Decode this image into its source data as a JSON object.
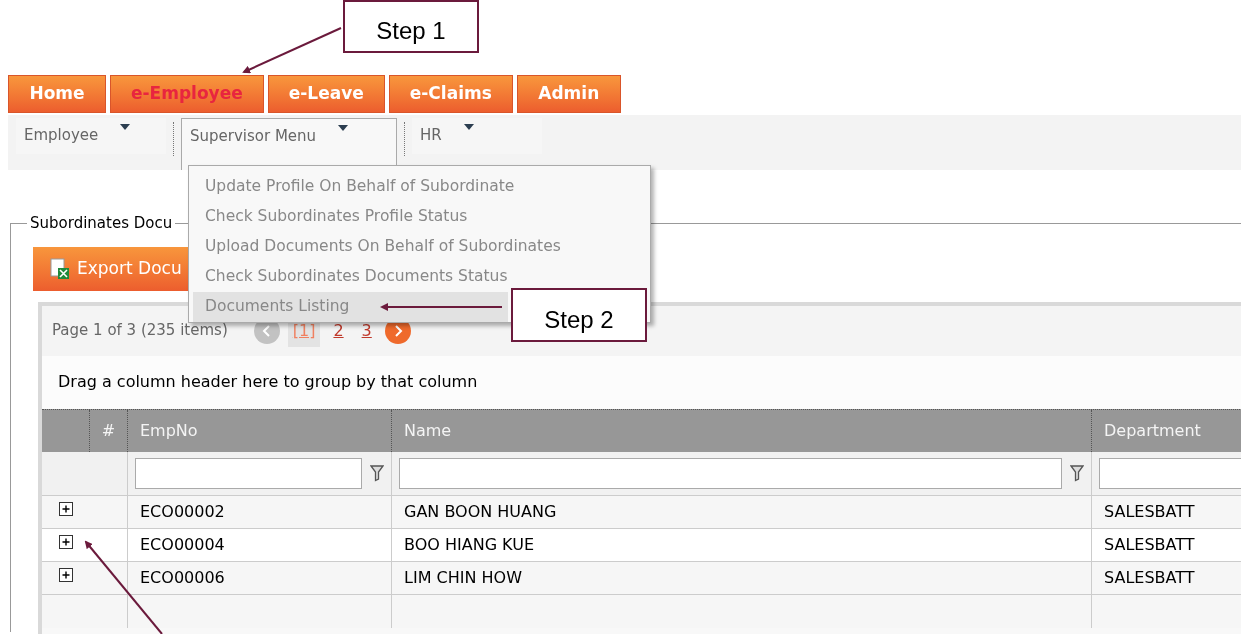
{
  "callouts": [
    {
      "text": "Step 1"
    },
    {
      "text": "Step 2"
    }
  ],
  "nav_tabs": [
    {
      "label": "Home",
      "selected": false
    },
    {
      "label": "e-Employee",
      "selected": true
    },
    {
      "label": "e-Leave",
      "selected": false
    },
    {
      "label": "e-Claims",
      "selected": false
    },
    {
      "label": "Admin",
      "selected": false
    }
  ],
  "sub_menu": [
    {
      "label": "Employee",
      "selected": false
    },
    {
      "label": "Supervisor Menu",
      "selected": true
    },
    {
      "label": "HR",
      "selected": false
    }
  ],
  "dropdown_items": [
    {
      "label": "Update Profile On Behalf of Subordinate",
      "selected": false
    },
    {
      "label": "Check Subordinates Profile Status",
      "selected": false
    },
    {
      "label": "Upload Documents On Behalf of Subordinates",
      "selected": false
    },
    {
      "label": "Check Subordinates Documents Status",
      "selected": false
    },
    {
      "label": "Documents Listing",
      "selected": true
    }
  ],
  "section": {
    "legend": "Subordinates Docu",
    "export_button": "Export Docu"
  },
  "pager": {
    "summary": "Page 1 of 3 (235 items)",
    "prev_enabled": false,
    "next_enabled": true,
    "pages": [
      {
        "label": "[1]",
        "selected": true
      },
      {
        "label": "2",
        "selected": false
      },
      {
        "label": "3",
        "selected": false
      }
    ]
  },
  "group_hint": "Drag a column header here to group by that column",
  "table": {
    "columns": [
      "#",
      "EmpNo",
      "Name",
      "Department"
    ],
    "rows": [
      {
        "empno": "ECO00002",
        "name": "GAN BOON HUANG",
        "department": "SALESBATT"
      },
      {
        "empno": "ECO00004",
        "name": "BOO HIANG KUE",
        "department": "SALESBATT"
      },
      {
        "empno": "ECO00006",
        "name": "LIM CHIN HOW",
        "department": "SALESBATT"
      }
    ]
  }
}
